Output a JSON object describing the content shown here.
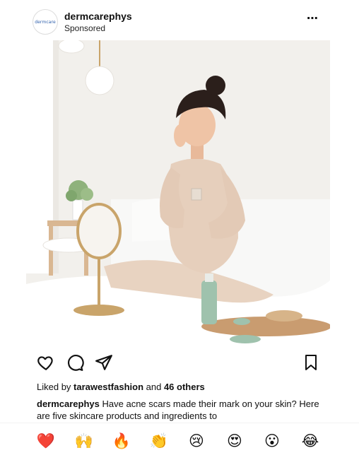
{
  "post": {
    "username": "dermcarephys",
    "sponsored": "Sponsored",
    "avatar_text": "dermcare",
    "more_icon": "⋯",
    "likes_prefix": "Liked by ",
    "likes_user": "tarawestfashion",
    "likes_mid": " and ",
    "likes_count": "46 others",
    "caption_user": "dermcarephys",
    "caption_text": " Have acne scars made their mark on your skin? Here are five skincare products and ingredients to"
  },
  "icons": [
    "heart-icon",
    "comment-icon",
    "share-icon",
    "bookmark-icon"
  ],
  "reactions": [
    {
      "glyph": "❤️",
      "name": "red-heart"
    },
    {
      "glyph": "🙌",
      "name": "raising-hands"
    },
    {
      "glyph": "🔥",
      "name": "fire"
    },
    {
      "glyph": "👏",
      "name": "clapping-hands"
    },
    {
      "glyph": "😢",
      "name": "crying-face"
    },
    {
      "glyph": "😍",
      "name": "heart-eyes"
    },
    {
      "glyph": "😮",
      "name": "surprised-face"
    },
    {
      "glyph": "😂",
      "name": "tears-of-joy"
    }
  ],
  "colors": {
    "text": "#111111",
    "brand": "#2a5caa"
  }
}
